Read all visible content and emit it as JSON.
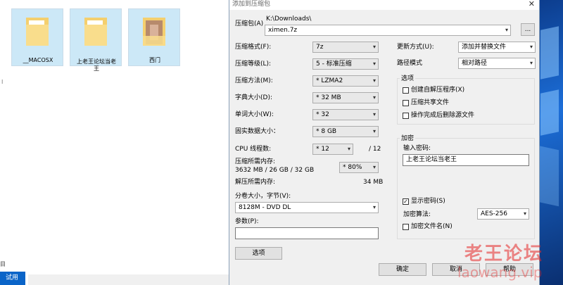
{
  "explorer": {
    "folders": [
      {
        "name": "__MACOSX"
      },
      {
        "name": "上老王论坛当老王"
      },
      {
        "name": "西门"
      }
    ],
    "side_mark": "I",
    "bottom_text": "目",
    "try_button": "试用"
  },
  "dialog": {
    "title": "添加到压缩包",
    "close_glyph": "✕",
    "archive": {
      "label": "压缩包(A)",
      "path": "K:\\Downloads\\",
      "value": "ximen.7z",
      "browse": "..."
    },
    "format": {
      "label": "压缩格式(F):",
      "value": "7z"
    },
    "level": {
      "label": "压缩等级(L):",
      "value": "5 - 标准压缩"
    },
    "method": {
      "label": "压缩方法(M):",
      "value": "* LZMA2"
    },
    "dict": {
      "label": "字典大小(D):",
      "value": "* 32 MB"
    },
    "word": {
      "label": "单词大小(W):",
      "value": "* 32"
    },
    "solid": {
      "label": "固实数据大小：",
      "value": "* 8 GB"
    },
    "cpu": {
      "label": "CPU 线程数:",
      "value": "* 12",
      "max": "/ 12"
    },
    "memory": {
      "label": "压缩所需内存:",
      "detail": "3632 MB / 26 GB / 32 GB",
      "value": "* 80%"
    },
    "decompress_memory": {
      "label": "解压所需内存:",
      "value": "34 MB"
    },
    "volume": {
      "label": "分卷大小，字节(V):",
      "value": "8128M - DVD DL"
    },
    "params": {
      "label": "参数(P):",
      "value": ""
    },
    "options_button": "选项",
    "update": {
      "label": "更新方式(U):",
      "value": "添加并替换文件"
    },
    "path_mode": {
      "label": "路径模式",
      "value": "相对路径"
    },
    "options_group": {
      "title": "选项",
      "items": [
        {
          "label": "创建自解压程序(X)",
          "checked": false
        },
        {
          "label": "压缩共享文件",
          "checked": false
        },
        {
          "label": "操作完成后删除源文件",
          "checked": false
        }
      ]
    },
    "encryption": {
      "title": "加密",
      "password_label": "输入密码:",
      "password": "上老王论坛当老王",
      "show_password": {
        "label": "显示密码(S)",
        "checked": true
      },
      "method_label": "加密算法:",
      "method_value": "AES-256",
      "encrypt_names": {
        "label": "加密文件名(N)",
        "checked": false
      }
    },
    "ok": "确定",
    "cancel": "取消",
    "help": "帮助"
  },
  "watermark": {
    "line1": "老王论坛",
    "line2": "laowang.vip"
  }
}
